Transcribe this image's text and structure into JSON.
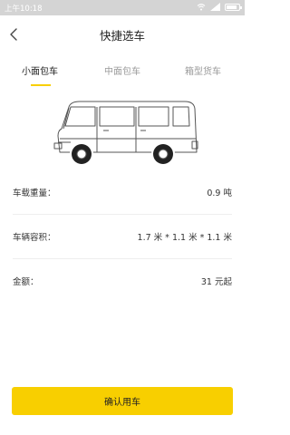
{
  "status_bar": {
    "time": "上午10:18"
  },
  "nav": {
    "title": "快捷选车"
  },
  "tabs": [
    {
      "label": "小面包车",
      "active": true
    },
    {
      "label": "中面包车",
      "active": false
    },
    {
      "label": "箱型货车",
      "active": false
    }
  ],
  "specs": [
    {
      "label": "车载重量：",
      "value": "0.9 吨"
    },
    {
      "label": "车辆容积：",
      "value": "1.7 米 * 1.1 米 * 1.1 米"
    },
    {
      "label": "金额：",
      "value": "31 元起"
    }
  ],
  "action": {
    "confirm_label": "确认用车"
  },
  "colors": {
    "accent": "#f8cf00",
    "status_bar": "#d4d4d4"
  },
  "icons": {
    "back": "chevron-left-icon",
    "vehicle": "van-illustration"
  }
}
